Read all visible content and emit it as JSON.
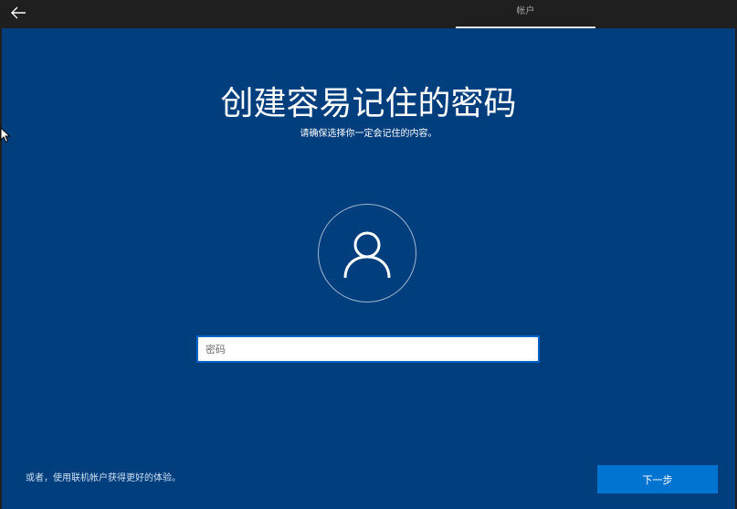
{
  "header": {
    "tab_label": "帐户"
  },
  "main": {
    "title": "创建容易记住的密码",
    "subtitle": "请确保选择你一定会记住的内容。",
    "password": {
      "placeholder": "密码",
      "value": ""
    },
    "online_link": "或者，使用联机帐户获得更好的体验。",
    "next_label": "下一步"
  },
  "icons": {
    "back": "back-arrow-icon",
    "avatar": "user-icon",
    "cursor": "mouse-pointer-icon"
  },
  "colors": {
    "background": "#003e7e",
    "topbar": "#1f1f1f",
    "accent_button": "#0074d0",
    "input_border": "#0063c7"
  }
}
